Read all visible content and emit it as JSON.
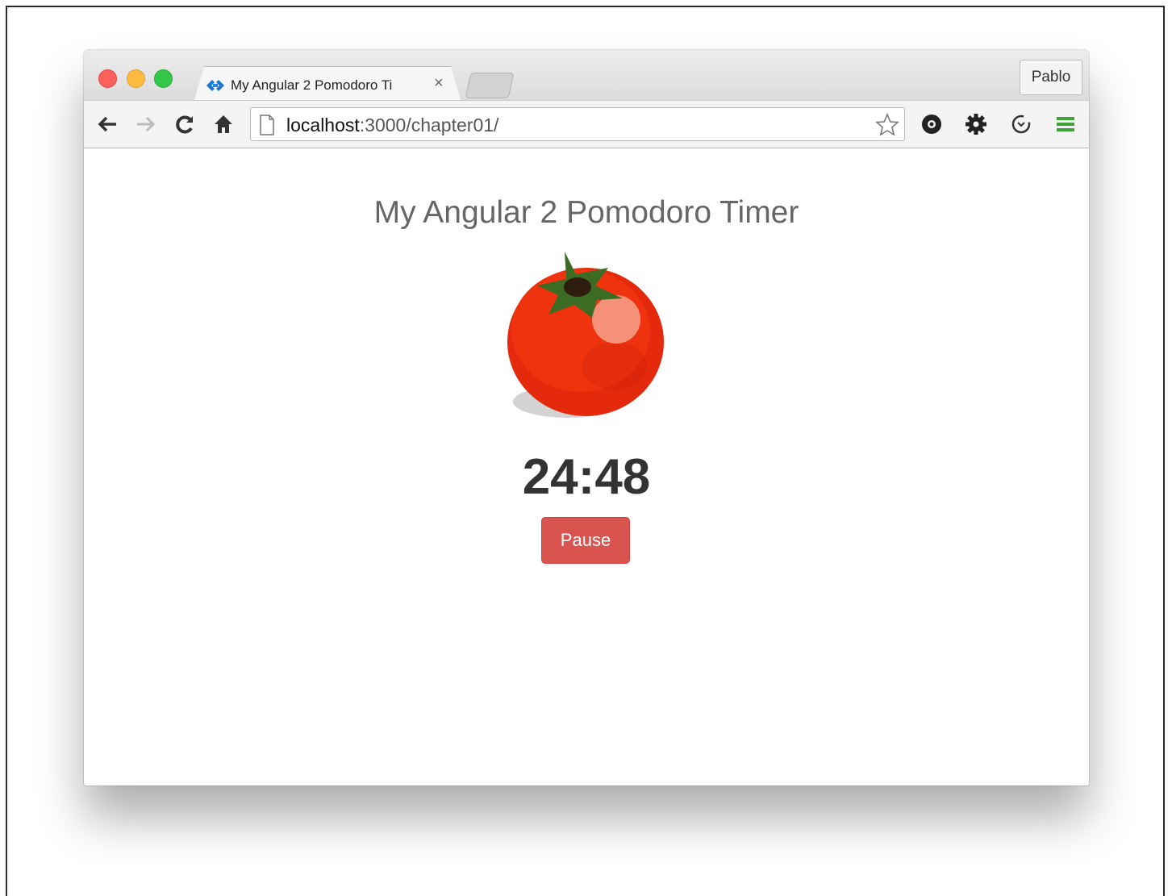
{
  "browser": {
    "tab_title": "My Angular 2 Pomodoro Ti",
    "tab_close": "×",
    "profile_name": "Pablo",
    "url_host": "localhost",
    "url_path": ":3000/chapter01/",
    "icons": [
      "back-arrow-icon",
      "forward-arrow-icon",
      "reload-icon",
      "home-icon",
      "page-icon",
      "star-icon",
      "extension-icon",
      "gear-icon",
      "sync-icon",
      "menu-icon"
    ]
  },
  "page": {
    "title": "My Angular 2 Pomodoro Timer",
    "time": "24:48",
    "pause_label": "Pause"
  },
  "colors": {
    "accent_button": "#d9534f",
    "tomato": "#e8290b"
  }
}
